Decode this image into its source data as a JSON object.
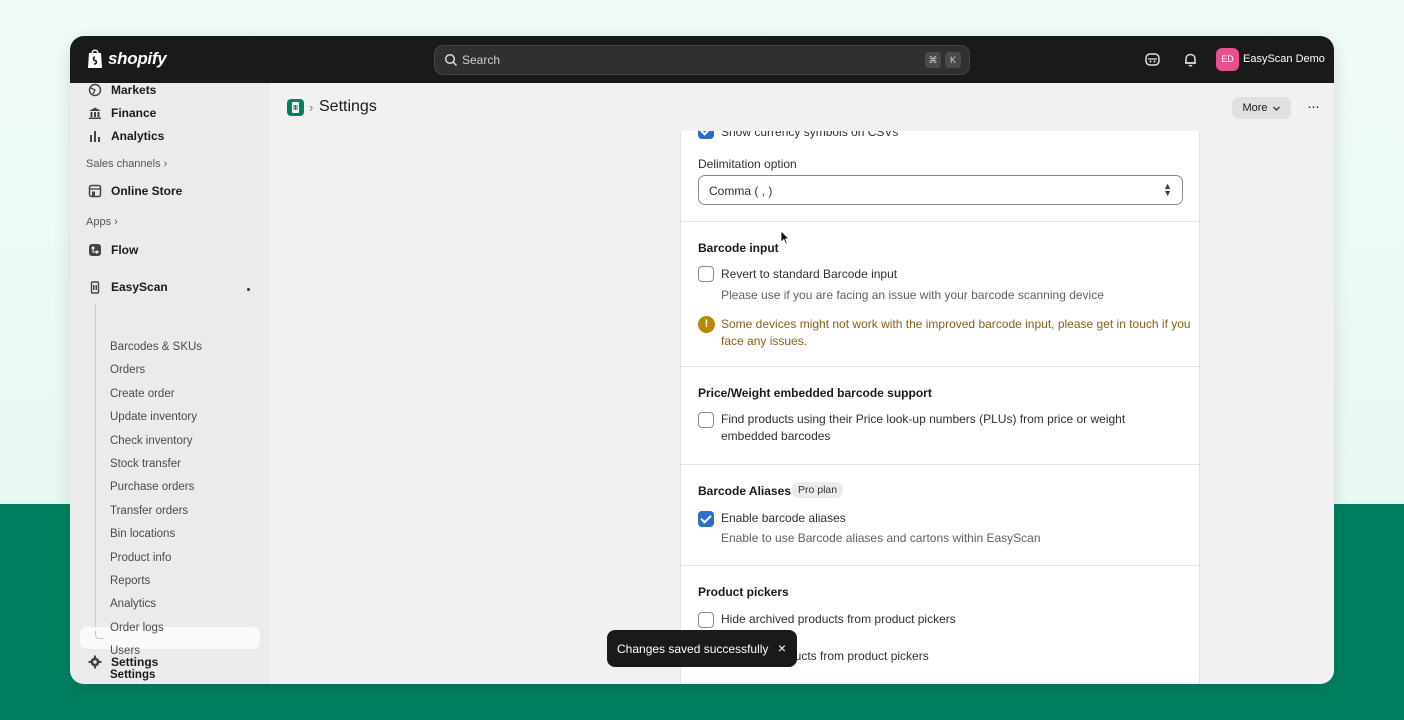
{
  "topbar": {
    "brand": "shopify",
    "search_placeholder": "Search",
    "shortcut_keys": [
      "⌘",
      "K"
    ],
    "avatar_initials": "ED",
    "store_name": "EasyScan Demo",
    "icons": [
      "shopify-bag-icon",
      "search-icon",
      "sidekick-icon",
      "bell-icon"
    ]
  },
  "sidebar": {
    "items_top": [
      {
        "label": "Markets",
        "icon": "globe-icon"
      },
      {
        "label": "Finance",
        "icon": "bank-icon"
      },
      {
        "label": "Analytics",
        "icon": "bar-chart-icon"
      }
    ],
    "sales_channels_label": "Sales channels ›",
    "online_store_label": "Online Store",
    "apps_label": "Apps ›",
    "flow_label": "Flow",
    "app_name": "EasyScan",
    "app_pinned_dot": "•",
    "app_subitems": [
      "Barcodes & SKUs",
      "Orders",
      "Create order",
      "Update inventory",
      "Check inventory",
      "Stock transfer",
      "Purchase orders",
      "Transfer orders",
      "Bin locations",
      "Product info",
      "Reports",
      "Analytics",
      "Order logs",
      "Users",
      "Settings"
    ],
    "settings_label": "Settings"
  },
  "header": {
    "separator": "›",
    "title": "Settings",
    "more_label": "More",
    "kebab": "···"
  },
  "card": {
    "csv_currency_label": "Show currency symbols on CSVs",
    "delimitation_label": "Delimitation option",
    "delimitation_value": "Comma ( , )",
    "barcode_input": {
      "heading": "Barcode input",
      "option": "Revert to standard Barcode input",
      "help": "Please use if you are facing an issue with your barcode scanning device",
      "warning": "Some devices might not work with the improved barcode input, please get in touch if you face any issues.",
      "checked": false
    },
    "price_weight": {
      "heading": "Price/Weight embedded barcode support",
      "option": "Find products using their Price look-up numbers (PLUs) from price or weight embedded barcodes",
      "checked": false
    },
    "aliases": {
      "heading": "Barcode Aliases",
      "badge": "Pro plan",
      "option": "Enable barcode aliases",
      "help": "Enable to use Barcode aliases and cartons within EasyScan",
      "checked": true
    },
    "pickers": {
      "heading": "Product pickers",
      "option1": "Hide archived products from product pickers",
      "option2_visible": "ducts from product pickers",
      "checked1": false
    }
  },
  "toast": {
    "message": "Changes saved successfully",
    "close": "×"
  },
  "colors": {
    "accent": "#008060",
    "checkbox": "#2c6ecb",
    "warning": "#b98900",
    "topbar": "#1a1a1a"
  }
}
